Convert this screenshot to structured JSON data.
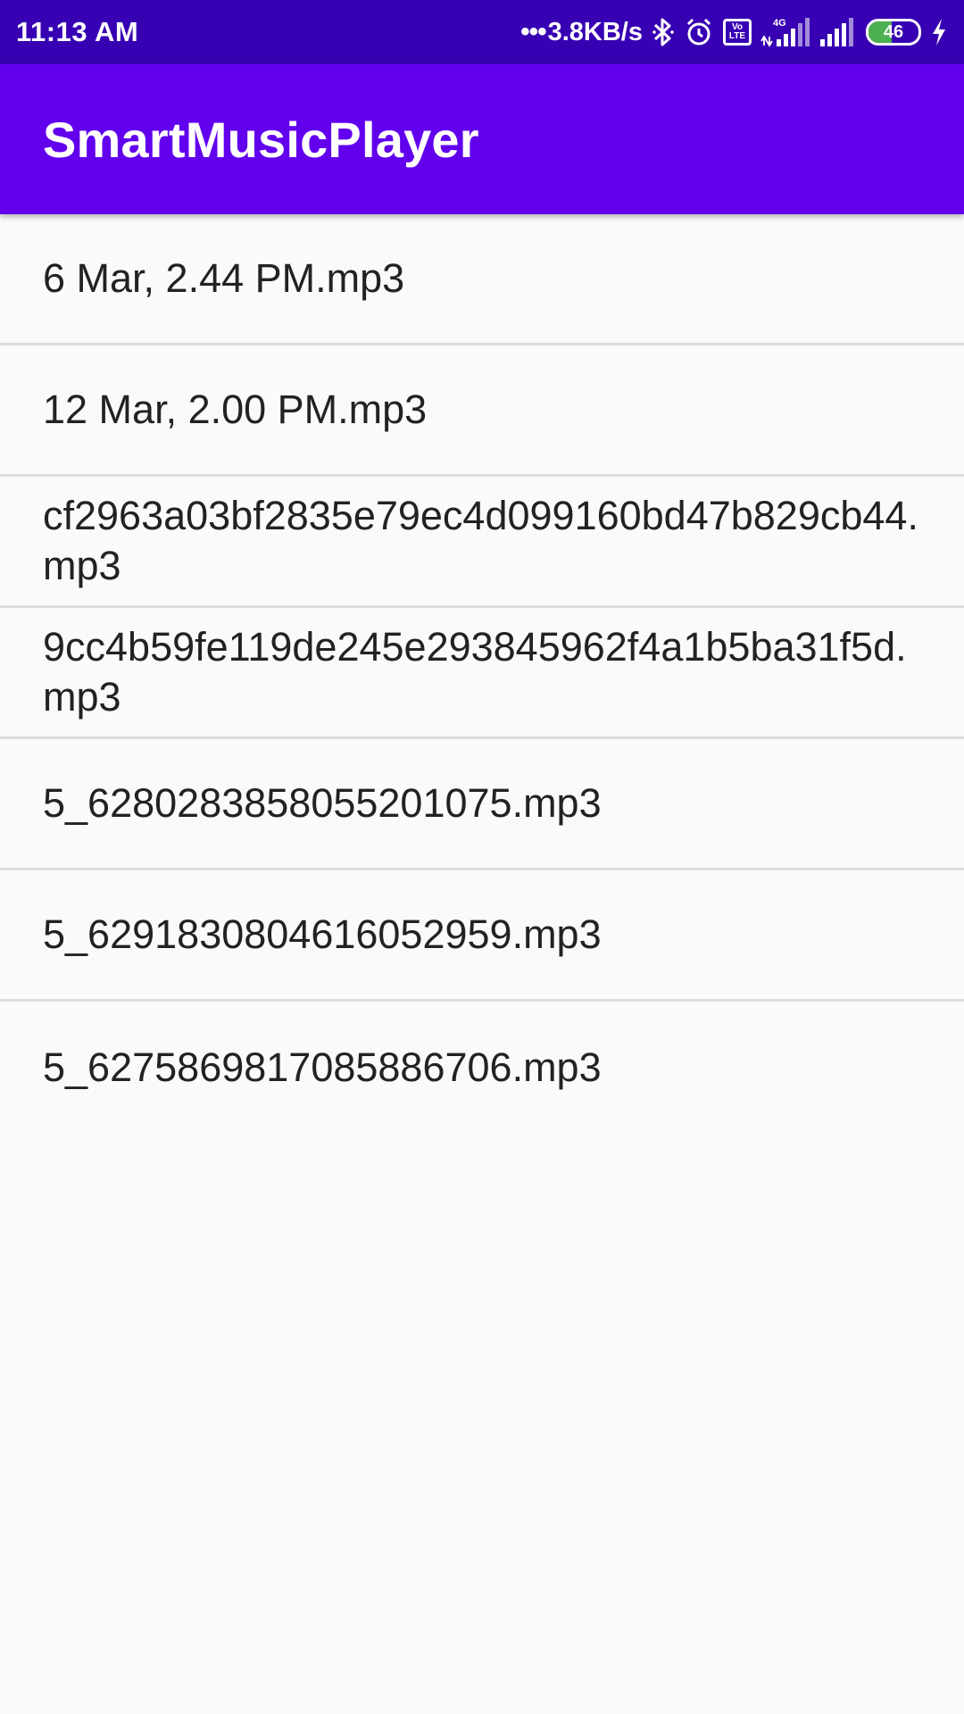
{
  "status_bar": {
    "time": "11:13 AM",
    "dots": "•••",
    "net_speed": "3.8KB/s",
    "battery_level": "46",
    "icons": [
      "bluetooth-icon",
      "alarm-icon",
      "volte-icon",
      "signal-4g-icon",
      "signal-icon",
      "battery-icon",
      "charging-icon"
    ],
    "volte_label": "Vo LTE",
    "network_type": "4G"
  },
  "app_bar": {
    "title": "SmartMusicPlayer",
    "color": "#6200ee"
  },
  "songs": [
    {
      "name": "6 Mar, 2.44 PM.mp3"
    },
    {
      "name": "12 Mar, 2.00 PM.mp3"
    },
    {
      "name": "cf2963a03bf2835e79ec4d099160bd47b829cb44.mp3"
    },
    {
      "name": "9cc4b59fe119de245e293845962f4a1b5ba31f5d.mp3"
    },
    {
      "name": "5_6280283858055201075.mp3"
    },
    {
      "name": "5_6291830804616052959.mp3"
    },
    {
      "name": "5_6275869817085886706.mp3"
    }
  ],
  "colors": {
    "status_bar": "#3700b3",
    "app_bar": "#6200ee",
    "background": "#fafafa",
    "divider": "#dcdcdc",
    "battery_fill": "#4caf50"
  }
}
